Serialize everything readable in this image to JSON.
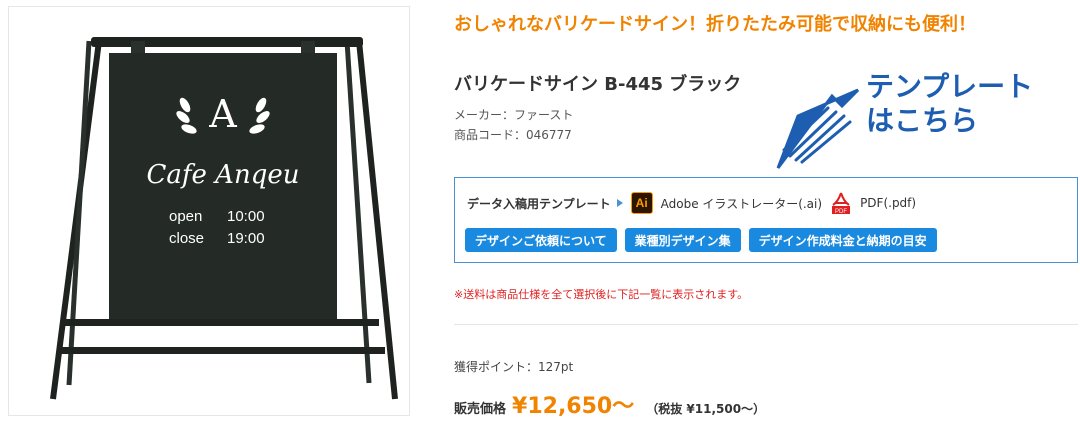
{
  "catchcopy": "おしゃれなバリケードサイン！折りたたみ可能で収納にも便利！",
  "product": {
    "name": "バリケードサイン B-445 ブラック",
    "maker": "メーカー：ファースト",
    "code": "商品コード：046777"
  },
  "sign": {
    "logo_letter": "A",
    "shop_name": "Cafe Anqeu",
    "hours_open": "open",
    "open_time": "10:00",
    "hours_close": "close",
    "close_time": "19:00"
  },
  "annotation": {
    "line1": "テンプレート",
    "line2": "はこちら",
    "icon": "hand-drawn-arrow-icon"
  },
  "template": {
    "label": "データ入稿用テンプレート",
    "ai_icon_text": "Ai",
    "ai_link": "Adobe イラストレーター(.ai)",
    "pdf_icon_text": "PDF",
    "pdf_link": "PDF(.pdf)",
    "buttons": [
      "デザインご依頼について",
      "業種別デザイン集",
      "デザイン作成料金と納期の目安"
    ]
  },
  "shipping_note": "※送料は商品仕様を全て選択後に下記一覧に表示されます。",
  "points": "獲得ポイント：127pt",
  "price": {
    "label": "販売価格",
    "value": "¥12,650〜",
    "tax": "（税抜 ¥11,500〜）"
  },
  "colors": {
    "accent_orange": "#f08300",
    "button_blue": "#1a8ae0",
    "annotation_blue": "#1e5eb0",
    "note_red": "#e02020"
  }
}
